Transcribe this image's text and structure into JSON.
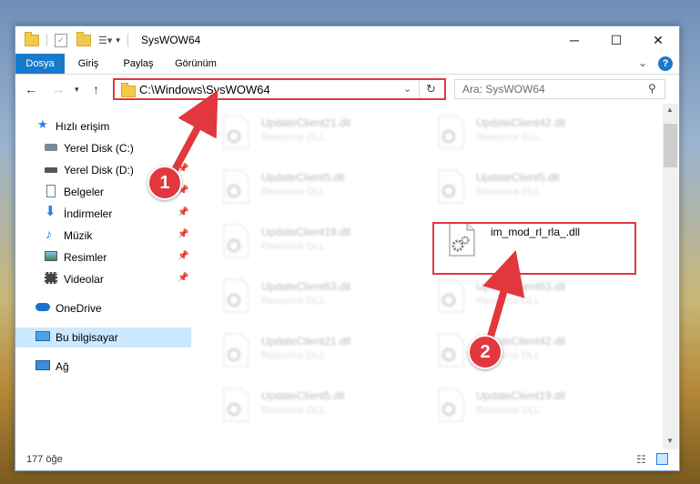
{
  "window": {
    "title": "SysWOW64",
    "minimize_glyph": "─",
    "maximize_glyph": "☐",
    "close_glyph": "✕"
  },
  "ribbon": {
    "tabs": [
      "Dosya",
      "Giriş",
      "Paylaş",
      "Görünüm"
    ],
    "help_glyph": "?",
    "collapse_glyph": "⌄"
  },
  "address": {
    "path": "C:\\Windows\\SysWOW64",
    "search_placeholder": "Ara: SysWOW64"
  },
  "sidebar": {
    "items": [
      {
        "label": "Hızlı erişim",
        "icon": "star-icon"
      },
      {
        "label": "Yerel Disk (C:)",
        "icon": "drive-icon"
      },
      {
        "label": "Yerel Disk (D:)",
        "icon": "drive-icon"
      },
      {
        "label": "Belgeler",
        "icon": "documents-icon"
      },
      {
        "label": "İndirmeler",
        "icon": "download-icon"
      },
      {
        "label": "Müzik",
        "icon": "music-icon"
      },
      {
        "label": "Resimler",
        "icon": "pictures-icon"
      },
      {
        "label": "Videolar",
        "icon": "videos-icon"
      },
      {
        "label": "OneDrive",
        "icon": "cloud-icon"
      },
      {
        "label": "Bu bilgisayar",
        "icon": "computer-icon"
      },
      {
        "label": "Ağ",
        "icon": "network-icon"
      }
    ]
  },
  "files": [
    {
      "name": "UpdateClient21.dll",
      "type": "Resource DLL"
    },
    {
      "name": "UpdateClient42.dll",
      "type": "Resource DLL"
    },
    {
      "name": "UpdateClient5.dll",
      "type": "Resource DLL"
    },
    {
      "name": "UpdateClient5.dll",
      "type": "Resource DLL"
    },
    {
      "name": "UpdateClient19.dll",
      "type": "Resource DLL"
    },
    {
      "name": "im_mod_rl_rla_.dll",
      "type": ""
    },
    {
      "name": "UpdateClient63.dll",
      "type": "Resource DLL"
    },
    {
      "name": "UpdateClient63.dll",
      "type": "Resource DLL"
    },
    {
      "name": "UpdateClient21.dll",
      "type": "Resource DLL"
    },
    {
      "name": "UpdateClient42.dll",
      "type": "Resource DLL"
    },
    {
      "name": "UpdateClient5.dll",
      "type": "Resource DLL"
    },
    {
      "name": "UpdateClient19.dll",
      "type": "Resource DLL"
    }
  ],
  "status": {
    "item_count": "177 öğe"
  },
  "annotations": {
    "step1": "1",
    "step2": "2",
    "color": "#e0383e"
  }
}
